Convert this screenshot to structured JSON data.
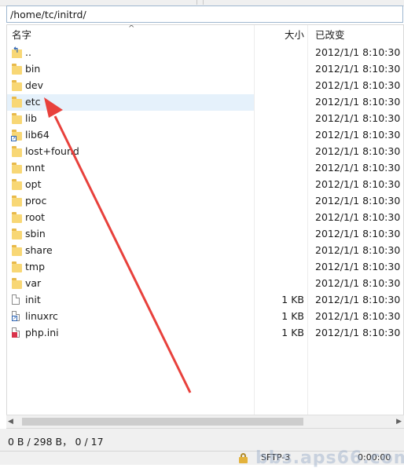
{
  "path": "/home/tc/initrd/",
  "columns": {
    "name": "名字",
    "size": "大小",
    "date": "已改变"
  },
  "files": [
    {
      "name": "..",
      "size": "",
      "date": "2012/1/1 8:10:30",
      "icon": "parent-dir-icon"
    },
    {
      "name": "bin",
      "size": "",
      "date": "2012/1/1 8:10:30",
      "icon": "folder-icon"
    },
    {
      "name": "dev",
      "size": "",
      "date": "2012/1/1 8:10:30",
      "icon": "folder-icon"
    },
    {
      "name": "etc",
      "size": "",
      "date": "2012/1/1 8:10:30",
      "icon": "folder-icon"
    },
    {
      "name": "lib",
      "size": "",
      "date": "2012/1/1 8:10:30",
      "icon": "folder-icon"
    },
    {
      "name": "lib64",
      "size": "",
      "date": "2012/1/1 8:10:30",
      "icon": "symlink-icon"
    },
    {
      "name": "lost+found",
      "size": "",
      "date": "2012/1/1 8:10:30",
      "icon": "folder-icon"
    },
    {
      "name": "mnt",
      "size": "",
      "date": "2012/1/1 8:10:30",
      "icon": "folder-icon"
    },
    {
      "name": "opt",
      "size": "",
      "date": "2012/1/1 8:10:30",
      "icon": "folder-icon"
    },
    {
      "name": "proc",
      "size": "",
      "date": "2012/1/1 8:10:30",
      "icon": "folder-icon"
    },
    {
      "name": "root",
      "size": "",
      "date": "2012/1/1 8:10:30",
      "icon": "folder-icon"
    },
    {
      "name": "sbin",
      "size": "",
      "date": "2012/1/1 8:10:30",
      "icon": "folder-icon"
    },
    {
      "name": "share",
      "size": "",
      "date": "2012/1/1 8:10:30",
      "icon": "folder-icon"
    },
    {
      "name": "tmp",
      "size": "",
      "date": "2012/1/1 8:10:30",
      "icon": "folder-icon"
    },
    {
      "name": "var",
      "size": "",
      "date": "2012/1/1 8:10:30",
      "icon": "folder-icon"
    },
    {
      "name": "init",
      "size": "1 KB",
      "date": "2012/1/1 8:10:30",
      "icon": "file-icon"
    },
    {
      "name": "linuxrc",
      "size": "1 KB",
      "date": "2012/1/1 8:10:30",
      "icon": "symlink-file-icon"
    },
    {
      "name": "php.ini",
      "size": "1 KB",
      "date": "2012/1/1 8:10:30",
      "icon": "ini-file-icon"
    }
  ],
  "status_text": "0 B / 298 B，  0 / 17",
  "bottom_bar": {
    "left_text": "SFTP-3",
    "right_text": "0:00:00"
  },
  "watermark": "bbs.aps66.com",
  "colors": {
    "selected_row": "#e5f1fb",
    "folder": "#f8d775",
    "annotation_arrow": "#e8413c"
  }
}
